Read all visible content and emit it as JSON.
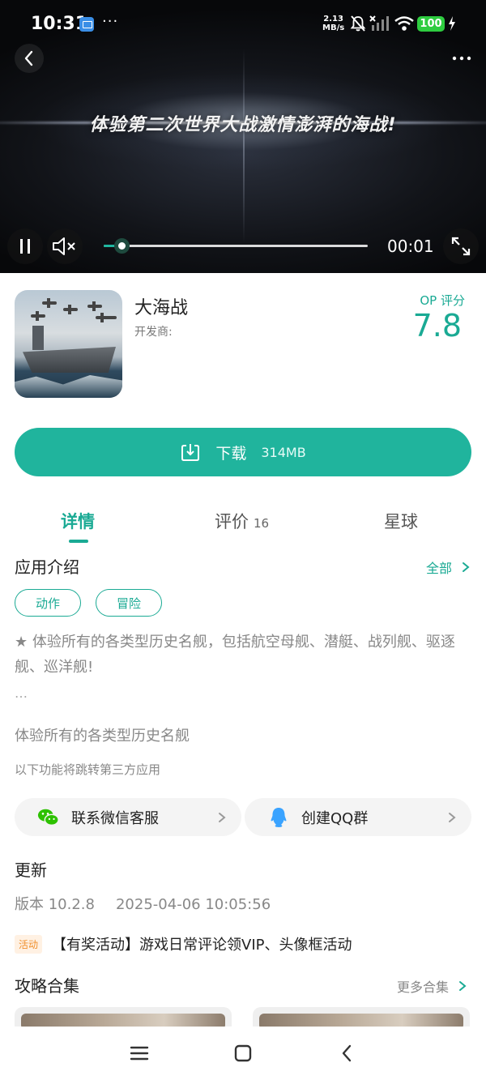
{
  "status_bar": {
    "time": "10:31",
    "dots": "···",
    "net_speed_value": "2.13",
    "net_speed_unit": "MB/s",
    "battery": "100"
  },
  "video": {
    "caption": "体验第二次世界大战激情澎湃的海战!",
    "current_time": "00:01",
    "progress_fraction": 0.07
  },
  "app": {
    "name": "大海战",
    "developer_label": "开发商:",
    "score_label": "OP 评分",
    "score": "7.8"
  },
  "download": {
    "label": "下载",
    "size": "314MB"
  },
  "tabs": [
    {
      "label": "详情",
      "active": true
    },
    {
      "label": "评价",
      "count": "16"
    },
    {
      "label": "星球"
    }
  ],
  "intro": {
    "title": "应用介绍",
    "all_link": "全部",
    "tags": [
      "动作",
      "冒险"
    ],
    "description": "★ 体验所有的各类型历史名舰，包括航空母舰、潜艇、战列舰、驱逐舰、巡洋舰!",
    "ellipsis": "…",
    "summary": "体验所有的各类型历史名舰",
    "third_party_note": "以下功能将跳转第三方应用"
  },
  "contacts": {
    "wechat": "联系微信客服",
    "qq": "创建QQ群"
  },
  "update": {
    "title": "更新",
    "version": "版本 10.2.8",
    "date": "2025-04-06 10:05:56"
  },
  "activity": {
    "badge": "活动",
    "text": "【有奖活动】游戏日常评论领VIP、头像框活动"
  },
  "guides": {
    "title": "攻略合集",
    "more_link": "更多合集"
  },
  "colors": {
    "accent": "#1aaa94",
    "button": "#20b49d",
    "badge_orange": "#f0902d"
  }
}
